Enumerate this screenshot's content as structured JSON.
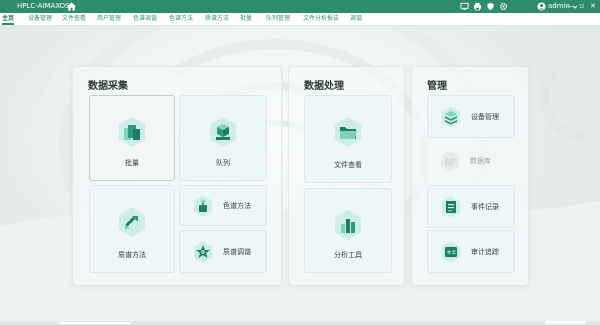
{
  "titlebar": {
    "app_title": "HPLC-AIMAXOS",
    "user": "admin",
    "window_buttons": [
      "—",
      "▫",
      "✕"
    ]
  },
  "menu": {
    "items": [
      {
        "label": "主页",
        "active": true
      },
      {
        "label": "设备管理"
      },
      {
        "label": "文件查看"
      },
      {
        "label": "用户管理"
      },
      {
        "label": "色谱调谐"
      },
      {
        "label": "色谱方法"
      },
      {
        "label": "质谱方法"
      },
      {
        "label": "批量"
      },
      {
        "label": "队列管理"
      },
      {
        "label": "文件分析报告"
      },
      {
        "label": "调谐"
      }
    ]
  },
  "panels": {
    "acquisition": {
      "title": "数据采集",
      "batch": "批量",
      "queue": "队列",
      "ms_method": "质谱方法",
      "lc_method": "色谱方法",
      "lc_tuning": "质谱调谐"
    },
    "processing": {
      "title": "数据处理",
      "file_view": "文件查看",
      "analysis": "分析工具"
    },
    "management": {
      "title": "管理",
      "device": "设备管理",
      "database": "数据库",
      "events": "事件记录",
      "audit": "审计追踪"
    }
  },
  "colors": {
    "accent": "#2e8b6e",
    "icon_dark": "#1f7c66",
    "icon_light": "#7fd0bd",
    "hex_bg": "#cdeee6"
  }
}
